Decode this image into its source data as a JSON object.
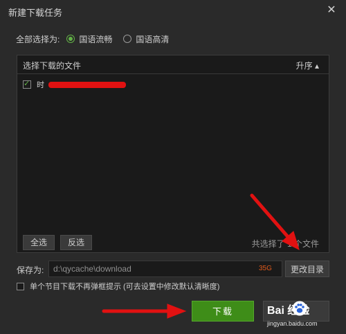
{
  "window": {
    "title": "新建下载任务",
    "close_glyph": "✕"
  },
  "quality": {
    "label": "全部选择为:",
    "options": [
      {
        "label": "国语流畅",
        "selected": true
      },
      {
        "label": "国语高清",
        "selected": false
      }
    ]
  },
  "file_list": {
    "header_label": "选择下载的文件",
    "sort_label": "升序 ▴",
    "files": [
      {
        "name_prefix": "时",
        "checked": true,
        "redacted": true
      }
    ],
    "select_all_label": "全选",
    "invert_label": "反选",
    "count_text": "共选择了 1 个文件"
  },
  "save": {
    "label": "保存为:",
    "path": "d:\\qycache\\download",
    "free_space": "35G",
    "change_dir_label": "更改目录"
  },
  "option": {
    "checked": false,
    "label": "单个节目下载不再弹框提示 (可去设置中修改默认清晰度)"
  },
  "actions": {
    "download_label": "下载"
  },
  "watermark": {
    "main": "Bai 经验",
    "sub": "jingyan.baidu.com"
  },
  "colors": {
    "accent_green": "#3e8d18",
    "annotation_red": "#e11111"
  }
}
